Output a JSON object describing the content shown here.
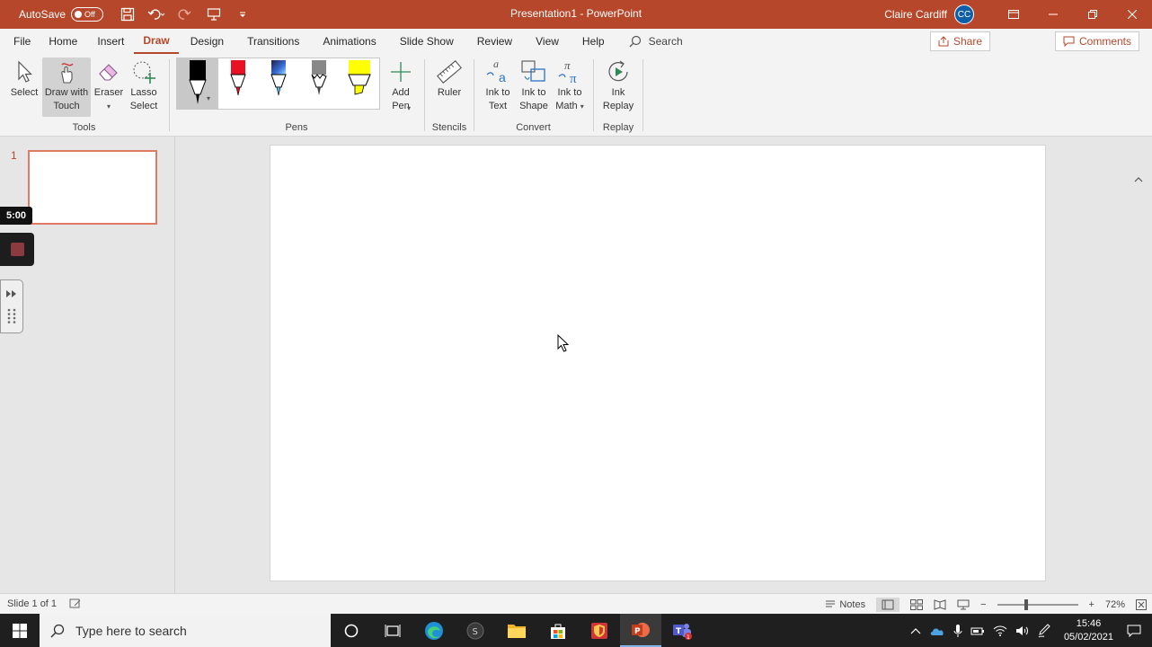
{
  "titlebar": {
    "autosave_label": "AutoSave",
    "autosave_state": "Off",
    "title": "Presentation1  -  PowerPoint",
    "user_name": "Claire Cardiff",
    "user_initials": "CC"
  },
  "tabs": [
    {
      "label": "File"
    },
    {
      "label": "Home"
    },
    {
      "label": "Insert"
    },
    {
      "label": "Draw",
      "active": true
    },
    {
      "label": "Design"
    },
    {
      "label": "Transitions"
    },
    {
      "label": "Animations"
    },
    {
      "label": "Slide Show"
    },
    {
      "label": "Review"
    },
    {
      "label": "View"
    },
    {
      "label": "Help"
    }
  ],
  "search": {
    "label": "Search"
  },
  "share_label": "Share",
  "comments_label": "Comments",
  "ribbon": {
    "tools": {
      "group_label": "Tools",
      "select": "Select",
      "draw_touch_1": "Draw with",
      "draw_touch_2": "Touch",
      "eraser": "Eraser",
      "lasso_1": "Lasso",
      "lasso_2": "Select"
    },
    "pens": {
      "group_label": "Pens",
      "add_pen_1": "Add",
      "add_pen_2": "Pen"
    },
    "stencils": {
      "group_label": "Stencils",
      "ruler": "Ruler"
    },
    "convert": {
      "group_label": "Convert",
      "ink_text_1": "Ink to",
      "ink_text_2": "Text",
      "ink_shape_1": "Ink to",
      "ink_shape_2": "Shape",
      "ink_math_1": "Ink to",
      "ink_math_2": "Math"
    },
    "replay": {
      "group_label": "Replay",
      "ink_replay_1": "Ink",
      "ink_replay_2": "Replay"
    }
  },
  "thumbnails": {
    "slide_number": "1"
  },
  "recording": {
    "timer": "5:00"
  },
  "status": {
    "slide_info": "Slide 1 of 1",
    "notes_label": "Notes",
    "zoom": "72%"
  },
  "taskbar": {
    "search_placeholder": "Type here to search",
    "time": "15:46",
    "date": "05/02/2021"
  },
  "colors": {
    "accent": "#b7472a",
    "pen_black": "#000000",
    "pen_red": "#e81123",
    "pen_galaxy": "#3a6fd8",
    "pen_gray": "#888888",
    "highlighter_yellow": "#ffff00"
  }
}
